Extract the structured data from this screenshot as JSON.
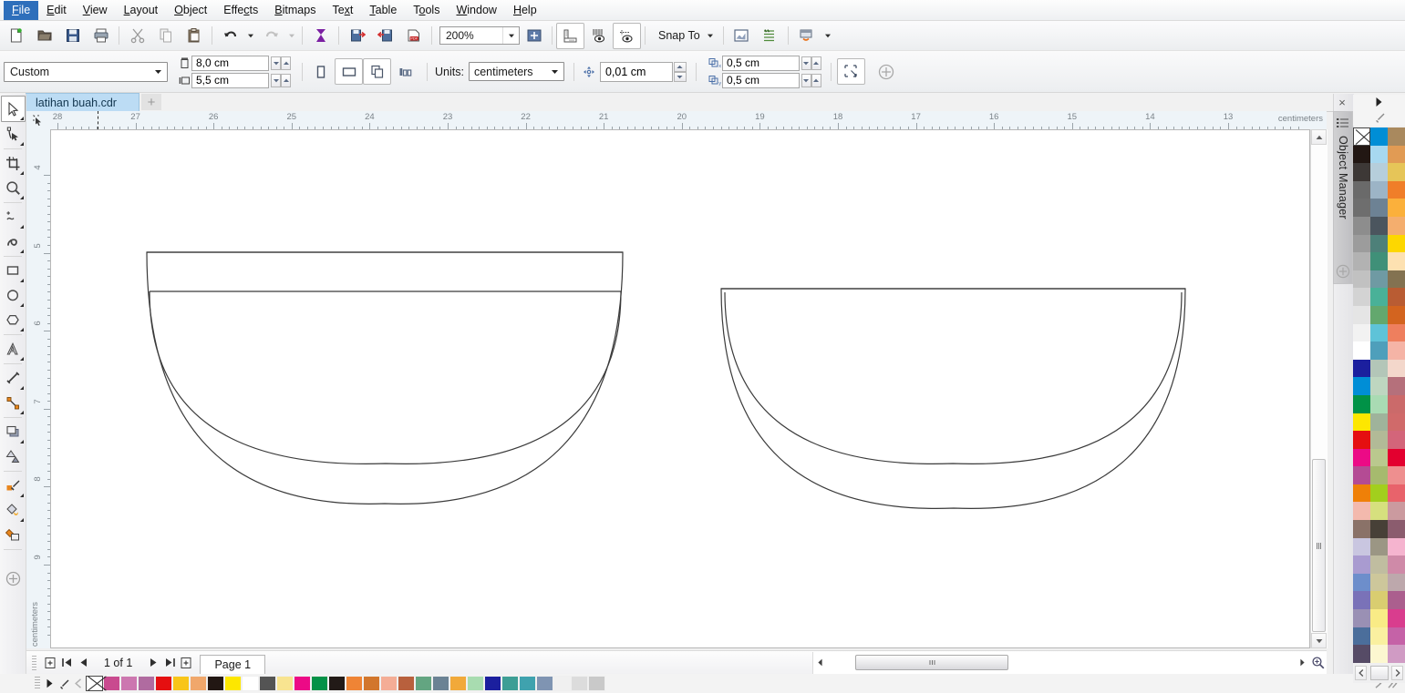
{
  "app": {
    "title": "CorelDRAW"
  },
  "menu": {
    "items": [
      {
        "label": "File",
        "mnemonic": "F"
      },
      {
        "label": "Edit",
        "mnemonic": "E"
      },
      {
        "label": "View",
        "mnemonic": "V"
      },
      {
        "label": "Layout",
        "mnemonic": "L"
      },
      {
        "label": "Object",
        "mnemonic": "O"
      },
      {
        "label": "Effects",
        "mnemonic": "c"
      },
      {
        "label": "Bitmaps",
        "mnemonic": "B"
      },
      {
        "label": "Text",
        "mnemonic": "x"
      },
      {
        "label": "Table",
        "mnemonic": "T"
      },
      {
        "label": "Tools",
        "mnemonic": "o"
      },
      {
        "label": "Window",
        "mnemonic": "W"
      },
      {
        "label": "Help",
        "mnemonic": "H"
      }
    ]
  },
  "toolbar": {
    "buttons": [
      {
        "name": "new-document",
        "label": "New"
      },
      {
        "name": "open-document",
        "label": "Open"
      },
      {
        "name": "save-document",
        "label": "Save"
      },
      {
        "name": "print",
        "label": "Print"
      },
      {
        "name": "cut",
        "label": "Cut"
      },
      {
        "name": "copy",
        "label": "Copy"
      },
      {
        "name": "paste",
        "label": "Paste"
      },
      {
        "name": "undo",
        "label": "Undo"
      },
      {
        "name": "redo",
        "label": "Redo"
      },
      {
        "name": "import",
        "label": "Import"
      },
      {
        "name": "export",
        "label": "Export"
      },
      {
        "name": "publish-pdf",
        "label": "Publish to PDF"
      },
      {
        "name": "zoom-levels",
        "label": "Zoom Levels"
      },
      {
        "name": "fullscreen-preview",
        "label": "Full-Screen Preview"
      },
      {
        "name": "show-rulers",
        "label": "Show Rulers"
      },
      {
        "name": "show-grid",
        "label": "Show Grid"
      },
      {
        "name": "show-guidelines",
        "label": "Show Guidelines"
      },
      {
        "name": "snap-to",
        "label": "Snap To"
      },
      {
        "name": "options",
        "label": "Options"
      },
      {
        "name": "application-launcher",
        "label": "Application Launcher"
      },
      {
        "name": "workspace",
        "label": "Workspace"
      }
    ],
    "zoom_level": "200%",
    "snap_to_label": "Snap To"
  },
  "property_bar": {
    "page_preset": "Custom",
    "page_width": "8,0 cm",
    "page_height": "5,5 cm",
    "orientation_portrait": "Portrait",
    "orientation_landscape": "Landscape",
    "all_pages": "All Pages",
    "current_page": "Current Page",
    "units_label": "Units:",
    "units_value": "centimeters",
    "nudge_distance": "0,01 cm",
    "duplicate_x": "0,5 cm",
    "duplicate_y": "0,5 cm",
    "drawing_scale": "Drawing Scale",
    "add_button": "Add"
  },
  "tabs": {
    "documents": [
      {
        "label": "latihan buah.cdr",
        "active": true
      }
    ],
    "new_tab": "+",
    "close": "×"
  },
  "toolbox": {
    "tools": [
      {
        "name": "pick-tool",
        "label": "Pick Tool",
        "selected": true,
        "flyout": true
      },
      {
        "name": "shape-tool",
        "label": "Shape Tool",
        "flyout": true
      },
      {
        "name": "crop-tool",
        "label": "Crop Tool",
        "flyout": true
      },
      {
        "name": "zoom-tool",
        "label": "Zoom Tool",
        "flyout": true
      },
      {
        "name": "freehand-tool",
        "label": "Freehand Tool",
        "flyout": true
      },
      {
        "name": "artistic-media-tool",
        "label": "Artistic Media Tool",
        "flyout": true
      },
      {
        "name": "rectangle-tool",
        "label": "Rectangle Tool",
        "flyout": true
      },
      {
        "name": "ellipse-tool",
        "label": "Ellipse Tool",
        "flyout": true
      },
      {
        "name": "polygon-tool",
        "label": "Polygon Tool",
        "flyout": true
      },
      {
        "name": "text-tool",
        "label": "Text Tool",
        "flyout": true
      },
      {
        "name": "parallel-dimension-tool",
        "label": "Parallel Dimension Tool",
        "flyout": true
      },
      {
        "name": "straight-line-connector-tool",
        "label": "Straight-Line Connector",
        "flyout": true
      },
      {
        "name": "drop-shadow-tool",
        "label": "Drop Shadow Tool",
        "flyout": true
      },
      {
        "name": "transparency-tool",
        "label": "Transparency Tool",
        "flyout": false
      },
      {
        "name": "color-eyedropper-tool",
        "label": "Color Eyedropper Tool",
        "flyout": true
      },
      {
        "name": "interactive-fill-tool",
        "label": "Interactive Fill Tool",
        "flyout": true
      },
      {
        "name": "smart-fill-tool",
        "label": "Smart Fill Tool",
        "flyout": false
      },
      {
        "name": "quick-customize",
        "label": "Quick Customize",
        "flyout": false
      }
    ]
  },
  "rulers": {
    "unit_label": "centimeters",
    "horizontal_ticks": [
      28,
      27,
      26,
      25,
      24,
      23,
      22,
      21,
      20,
      19,
      18,
      17,
      16,
      15,
      14,
      13
    ],
    "vertical_ticks": [
      4,
      5,
      6,
      7,
      8,
      9
    ]
  },
  "status_bar": {
    "page_count": "1 of 1",
    "page_tab": "Page 1",
    "first_page": "◀│",
    "prev_page": "◀",
    "next_page": "▶",
    "last_page": "│▶",
    "add_page_before": "Add Page Before",
    "add_page_after": "Add Page After"
  },
  "docker": {
    "title": "Object Manager",
    "close": "×",
    "add": "+"
  },
  "bottom_palette": {
    "none_label": "No Color",
    "colors": [
      "#c94a8f",
      "#cc77b0",
      "#b06ba0",
      "#e50f10",
      "#f8c518",
      "#f0a76b",
      "#221713",
      "#fde700",
      "#ffffff",
      "#545454",
      "#f8e490",
      "#ec0a86",
      "#049147",
      "#221a17",
      "#ef8435",
      "#d2762c",
      "#f4ad96",
      "#b8603d",
      "#63a581",
      "#6b8294",
      "#f1a93a",
      "#a8dcb0",
      "#1b1f9e",
      "#3d9e95",
      "#3fa2ae",
      "#7f94b2",
      "#f0f0f0",
      "#dcdcdc",
      "#c9c9c9"
    ]
  },
  "right_palette": {
    "none_label": "No Color",
    "column1": [
      "#221713",
      "#3d3836",
      "#6a6a6a",
      "#6e6e6e",
      "#8d8d8d",
      "#9c9c9c",
      "#b2b2b2",
      "#c1c1c1",
      "#d3d3d3",
      "#e5e5e5",
      "#f2f2f2",
      "#ffffff",
      "#1b1f9e",
      "#008ed6",
      "#019247",
      "#fde700",
      "#e50f10",
      "#ec0a86",
      "#b44b94",
      "#ef8008",
      "#f3b9ad",
      "#8a7268",
      "#c9c6e0",
      "#a99bd0",
      "#6d8ecb",
      "#7a72b8",
      "#9a90b4",
      "#4b6e9b",
      "#564b66",
      "#7189a5"
    ],
    "column2": [
      "#008ed6",
      "#a7d8f0",
      "#b6cedb",
      "#9cb4c6",
      "#6d8294",
      "#4b555e",
      "#4d8079",
      "#3f9078",
      "#6f9aa3",
      "#49b198",
      "#63a86e",
      "#5ec3d8",
      "#4e9fbb",
      "#b3c6b8",
      "#bed6c0",
      "#a9dbb3",
      "#9fb39b",
      "#b2ba97",
      "#bac88e",
      "#a6ba6e",
      "#a2cf1d",
      "#d6e07e",
      "#474037",
      "#9b9684",
      "#c0bda0",
      "#cdc79b",
      "#d9cd70",
      "#f9eb86",
      "#faf0a0",
      "#fcf7d0"
    ],
    "column3": [
      "#a9895e",
      "#e19b54",
      "#e6c558",
      "#f07e29",
      "#fbb03b",
      "#f4ae6e",
      "#fdd700",
      "#fde1b1",
      "#837251",
      "#b95c33",
      "#d3641f",
      "#ee7f5e",
      "#f5b4a6",
      "#f3d7cb",
      "#b5707b",
      "#cb6a6a",
      "#d06a6a",
      "#d3657a",
      "#e3002f",
      "#ee8f8f",
      "#e8636b",
      "#cb9a9f",
      "#8b5c6e",
      "#f5b4cf",
      "#cf8aa8",
      "#bda8ac",
      "#ab5f8e",
      "#d93d8e",
      "#c562a7",
      "#d09bc4"
    ]
  },
  "drawing": {
    "title": "watermelon-slice-outlines",
    "shapes": [
      {
        "name": "watermelon-slice-left",
        "description": "half-circle slice with rind band and top bar"
      },
      {
        "name": "watermelon-slice-right",
        "description": "half-circle slice with rind band"
      }
    ]
  }
}
